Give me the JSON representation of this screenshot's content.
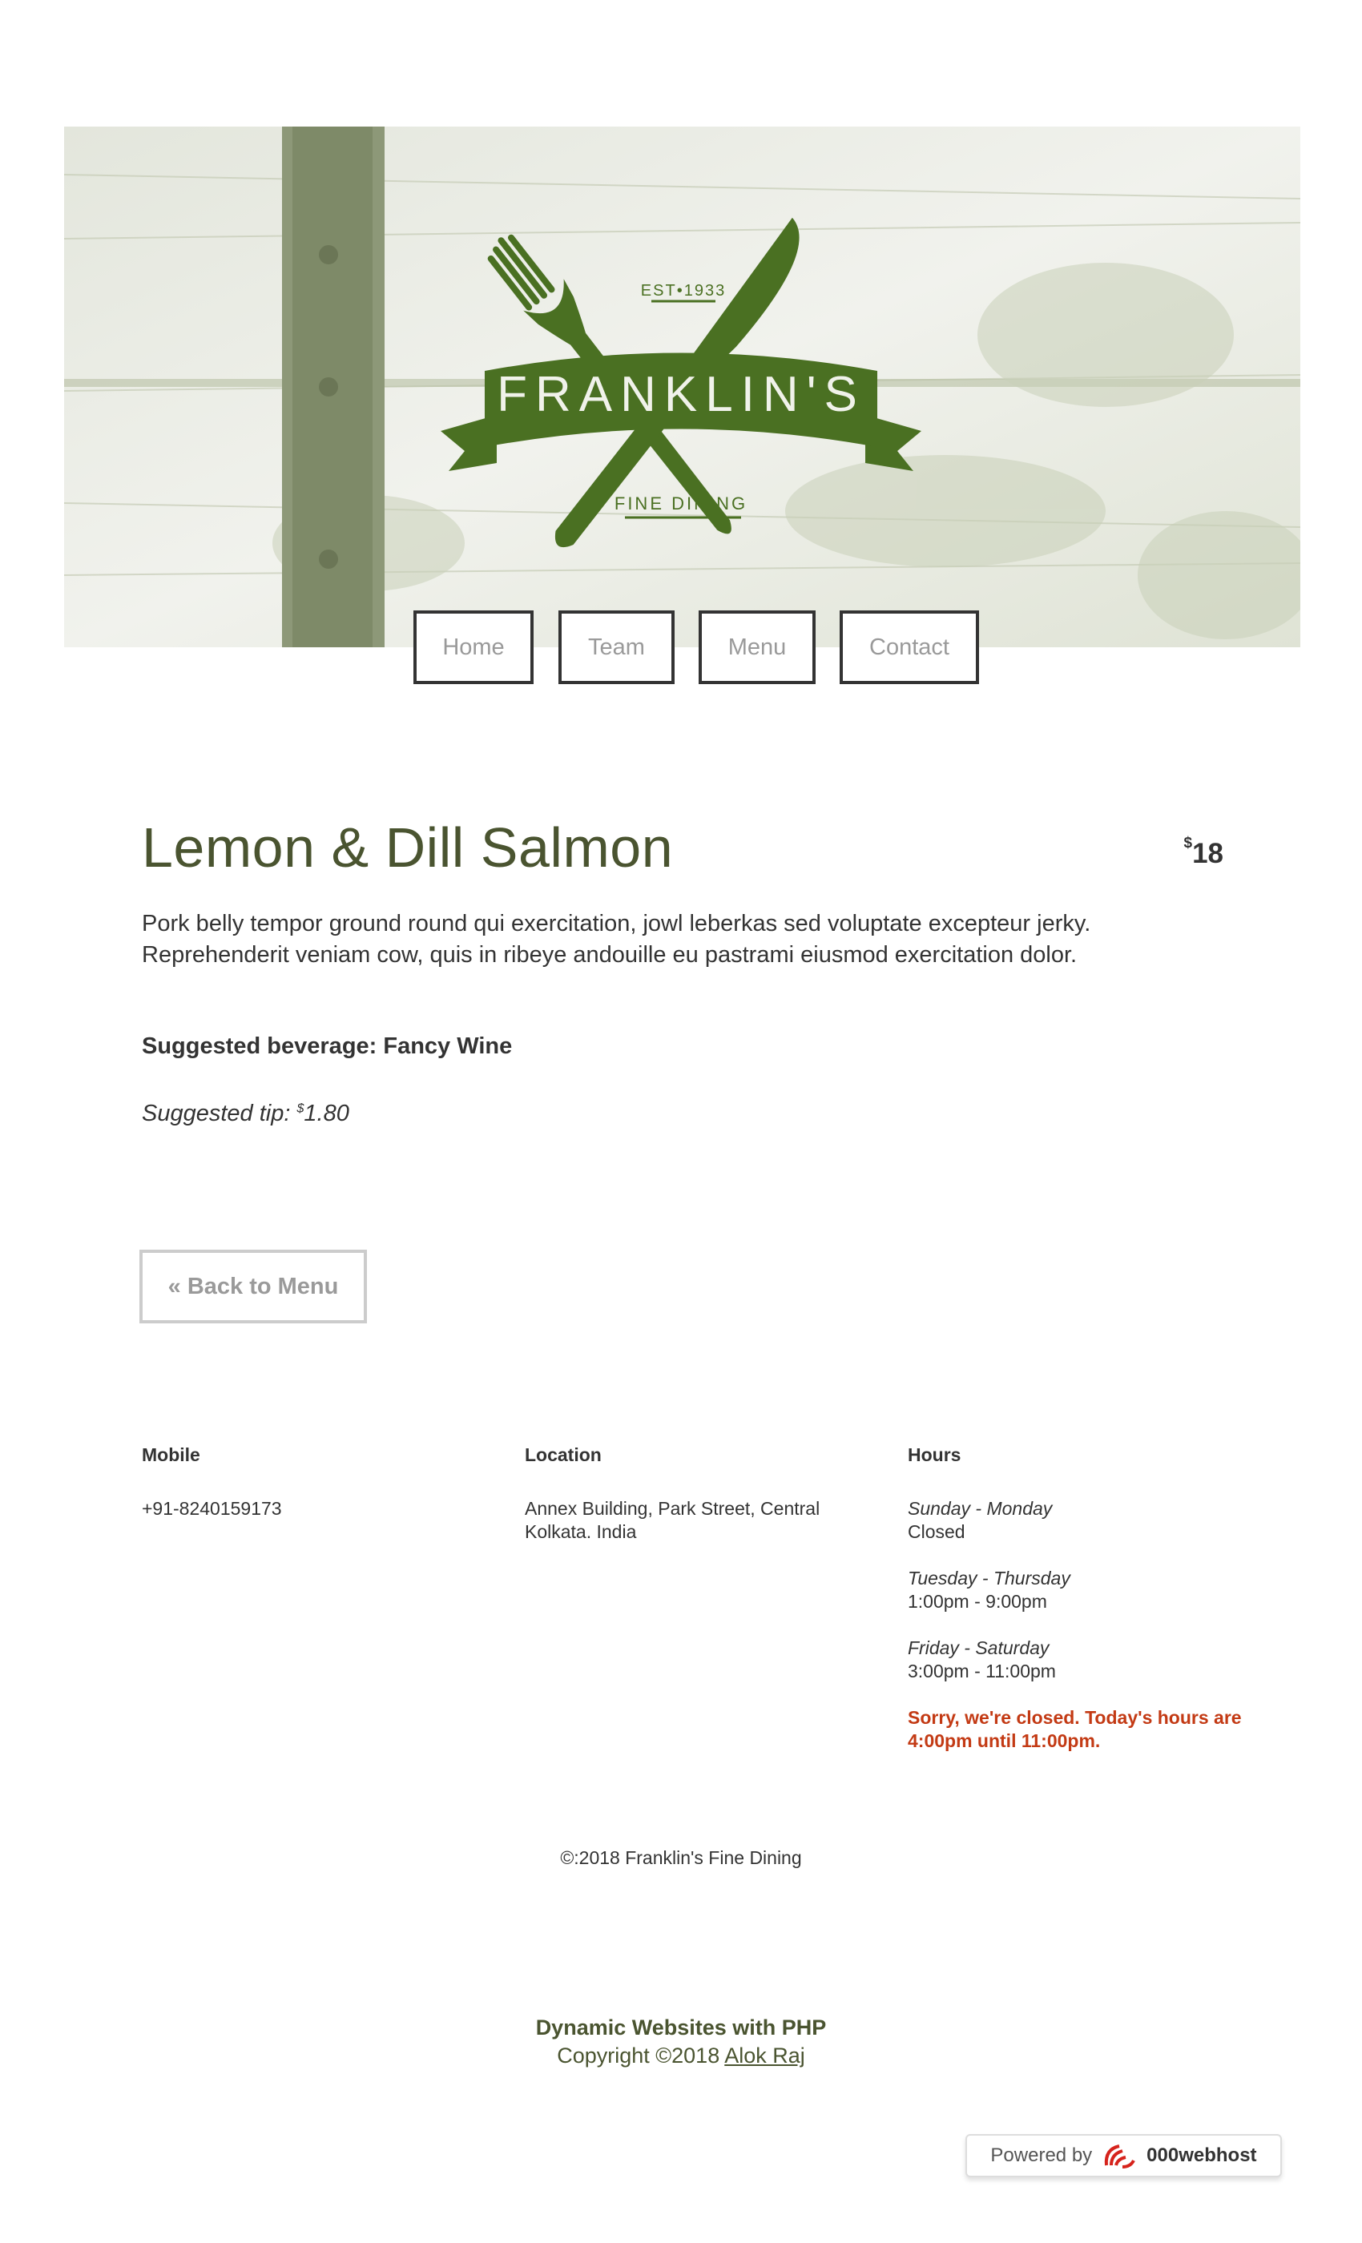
{
  "header": {
    "logo": {
      "name": "FRANKLIN'S",
      "tagline": "FINE DINING",
      "established": "EST•1933"
    }
  },
  "nav": {
    "items": [
      {
        "label": "Home"
      },
      {
        "label": "Team"
      },
      {
        "label": "Menu"
      },
      {
        "label": "Contact"
      }
    ]
  },
  "dish": {
    "title": "Lemon & Dill Salmon",
    "currency": "$",
    "price": "18",
    "description": "Pork belly tempor ground round qui exercitation, jowl leberkas sed voluptate excepteur jerky. Reprehenderit veniam cow, quis in ribeye andouille eu pastrami eiusmod exercitation dolor.",
    "beverage": "Suggested beverage: Fancy Wine",
    "tip_label": "Suggested tip: ",
    "tip_currency": "$",
    "tip_value": "1.80"
  },
  "back_button": {
    "label": "« Back to Menu"
  },
  "info": {
    "mobile": {
      "heading": "Mobile",
      "value": "+91-8240159173"
    },
    "location": {
      "heading": "Location",
      "line1": "Annex Building, Park Street, Central",
      "line2": "Kolkata. India"
    },
    "hours": {
      "heading": "Hours",
      "days": [
        {
          "day": "Sunday - Monday",
          "time": "Closed"
        },
        {
          "day": "Tuesday - Thursday",
          "time": "1:00pm - 9:00pm"
        },
        {
          "day": "Friday - Saturday",
          "time": "3:00pm - 11:00pm"
        }
      ],
      "status": "Sorry, we're closed. Today's hours are 4:00pm until 11:00pm."
    }
  },
  "copyright": "©:2018 Franklin's Fine Dining",
  "credit": {
    "title": "Dynamic Websites with PHP",
    "copy_prefix": "Copyright ©2018 ",
    "author": "Alok Raj"
  },
  "badge": {
    "prefix": "Powered by",
    "brand": "000webhost"
  },
  "colors": {
    "brand_green": "#4a7022",
    "heading_olive": "#4a5430",
    "closed_red": "#c33a14"
  }
}
